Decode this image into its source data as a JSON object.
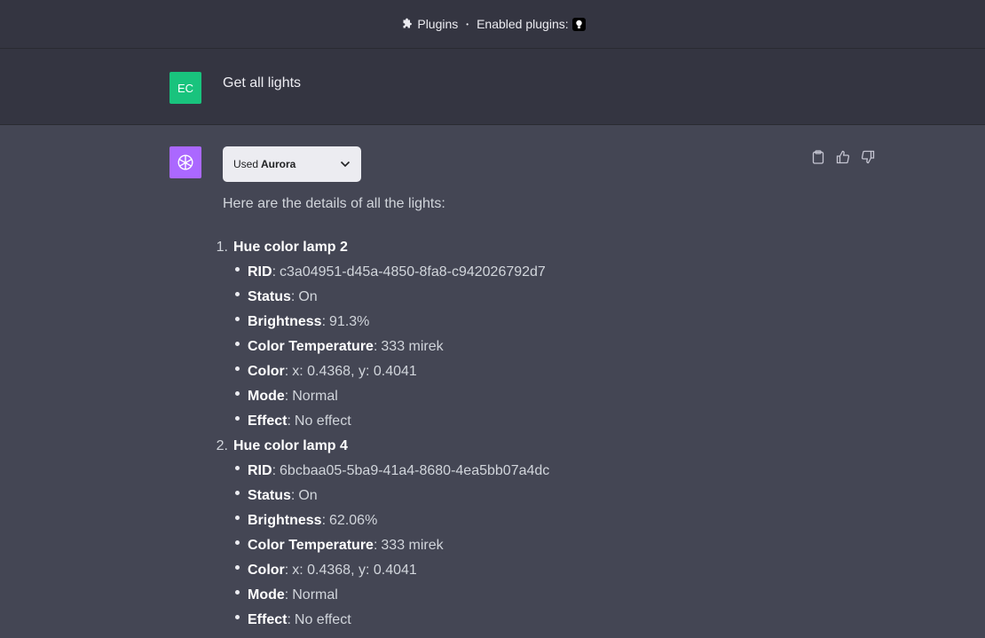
{
  "header": {
    "plugins_label": "Plugins",
    "separator": "•",
    "enabled_label": "Enabled plugins:"
  },
  "user_message": {
    "avatar_initials": "EC",
    "avatar_color": "#19c37d",
    "text": "Get all lights"
  },
  "assistant_message": {
    "avatar_color": "#ab68ff",
    "plugin_used_prefix": "Used",
    "plugin_name": "Aurora",
    "intro": "Here are the details of all the lights:",
    "lamps": [
      {
        "number": "1.",
        "title": "Hue color lamp 2",
        "props": [
          {
            "key": "RID",
            "value": "c3a04951-d45a-4850-8fa8-c942026792d7"
          },
          {
            "key": "Status",
            "value": "On"
          },
          {
            "key": "Brightness",
            "value": "91.3%"
          },
          {
            "key": "Color Temperature",
            "value": "333 mirek"
          },
          {
            "key": "Color",
            "value": "x: 0.4368, y: 0.4041"
          },
          {
            "key": "Mode",
            "value": "Normal"
          },
          {
            "key": "Effect",
            "value": "No effect"
          }
        ]
      },
      {
        "number": "2.",
        "title": "Hue color lamp 4",
        "props": [
          {
            "key": "RID",
            "value": "6bcbaa05-5ba9-41a4-8680-4ea5bb07a4dc"
          },
          {
            "key": "Status",
            "value": "On"
          },
          {
            "key": "Brightness",
            "value": "62.06%"
          },
          {
            "key": "Color Temperature",
            "value": "333 mirek"
          },
          {
            "key": "Color",
            "value": "x: 0.4368, y: 0.4041"
          },
          {
            "key": "Mode",
            "value": "Normal"
          },
          {
            "key": "Effect",
            "value": "No effect"
          }
        ]
      }
    ],
    "actions": [
      "clipboard-icon",
      "thumbs-up-icon",
      "thumbs-down-icon"
    ]
  },
  "colors": {
    "page_bg": "#343541",
    "assistant_bg": "#444654"
  }
}
